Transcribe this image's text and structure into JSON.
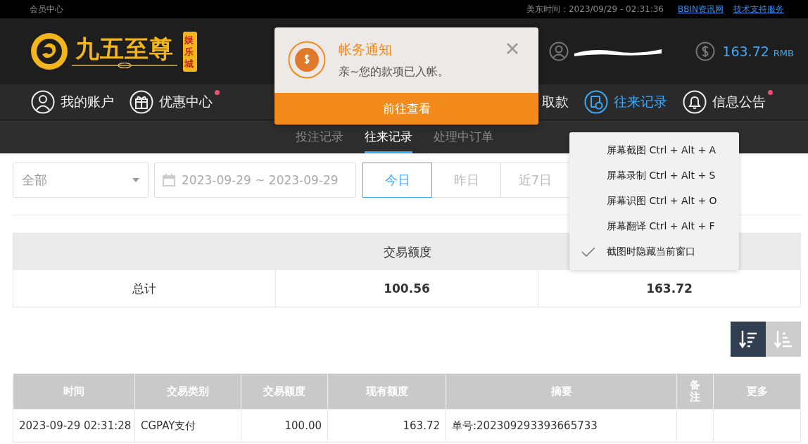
{
  "top_bar": {
    "member_center": "会员中心",
    "time": "美东时间：2023/09/29 - 02:31:36",
    "links": [
      "BBIN资讯网",
      "技术支持服务"
    ]
  },
  "brand": {
    "name": "九五至尊",
    "badge": "娱乐城"
  },
  "account": {
    "balance": "163.72",
    "currency": "RMB"
  },
  "nav": [
    {
      "label": "我的账户",
      "kind": "user",
      "selected": false,
      "dot": false
    },
    {
      "label": "优惠中心",
      "kind": "gift",
      "selected": false,
      "dot": true
    },
    {
      "label": "取款",
      "kind": "partial",
      "selected": false
    },
    {
      "label": "往来记录",
      "kind": "record",
      "selected": true,
      "dot": false
    },
    {
      "label": "信息公告",
      "kind": "bell",
      "selected": false,
      "dot": true
    }
  ],
  "notification": {
    "title": "帐务通知",
    "message": "亲~您的款项已入帐。",
    "action": "前往查看"
  },
  "sub_tabs": [
    {
      "label": "投注记录",
      "selected": false
    },
    {
      "label": "往来记录",
      "selected": true
    },
    {
      "label": "处理中订单",
      "selected": false
    }
  ],
  "filters": {
    "type": "全部",
    "date_range": "2023-09-29 ~ 2023-09-29",
    "ranges": [
      {
        "label": "今日",
        "selected": true
      },
      {
        "label": "昨日",
        "selected": false
      },
      {
        "label": "近7日",
        "selected": false
      }
    ]
  },
  "context_menu": [
    {
      "label": "屏幕截图 Ctrl + Alt + A",
      "checked": false
    },
    {
      "label": "屏幕录制 Ctrl + Alt + S",
      "checked": false
    },
    {
      "label": "屏幕识图 Ctrl + Alt + O",
      "checked": false
    },
    {
      "label": "屏幕翻译 Ctrl + Alt + F",
      "checked": false
    },
    {
      "label": "截图时隐藏当前窗口",
      "checked": true
    }
  ],
  "summary": {
    "header": "交易额度",
    "row": [
      "总计",
      "100.56",
      "163.72"
    ]
  },
  "sort_buttons": [
    {
      "kind": "desc",
      "selected": true
    },
    {
      "kind": "asc",
      "selected": false
    }
  ],
  "table": {
    "columns": [
      "时间",
      "交易类别",
      "交易额度",
      "现有额度",
      "摘要",
      "备注",
      "更多"
    ],
    "rows": [
      [
        "2023-09-29 02:31:28",
        "CGPAY支付",
        "100.00",
        "163.72",
        "单号:202309293393665733",
        "",
        ""
      ]
    ]
  }
}
